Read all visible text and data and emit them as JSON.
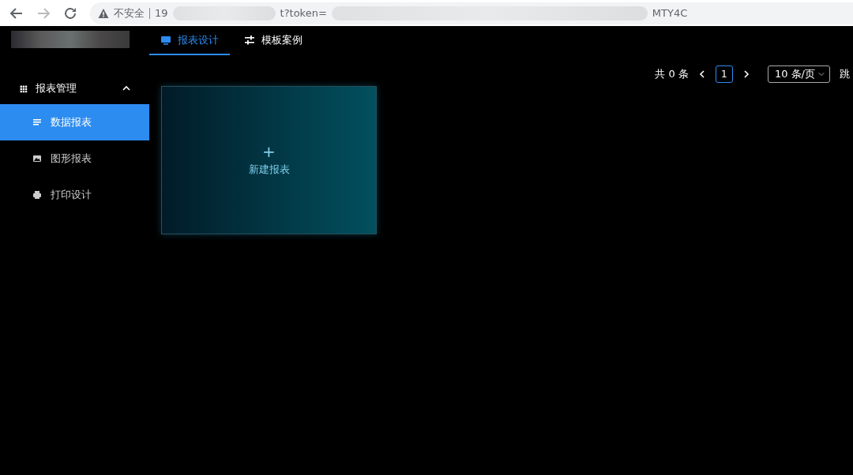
{
  "browser": {
    "security_label": "不安全",
    "url_parts": [
      "19",
      "t?token=",
      "MTY4C"
    ]
  },
  "header": {
    "tabs": [
      {
        "label": "报表设计",
        "selected": true
      },
      {
        "label": "模板案例",
        "selected": false
      }
    ]
  },
  "sidebar": {
    "group": {
      "label": "报表管理",
      "expanded": true,
      "items": [
        {
          "label": "数据报表",
          "selected": true
        },
        {
          "label": "图形报表",
          "selected": false
        },
        {
          "label": "打印设计",
          "selected": false
        }
      ]
    }
  },
  "pagination": {
    "total": "共 0 条",
    "pages": [
      {
        "label": "1",
        "selected": true
      }
    ],
    "page_size": "10 条/页",
    "jump_label": "跳"
  },
  "cards": [
    {
      "kind": "new",
      "icon": "+",
      "label": "新建报表"
    }
  ]
}
